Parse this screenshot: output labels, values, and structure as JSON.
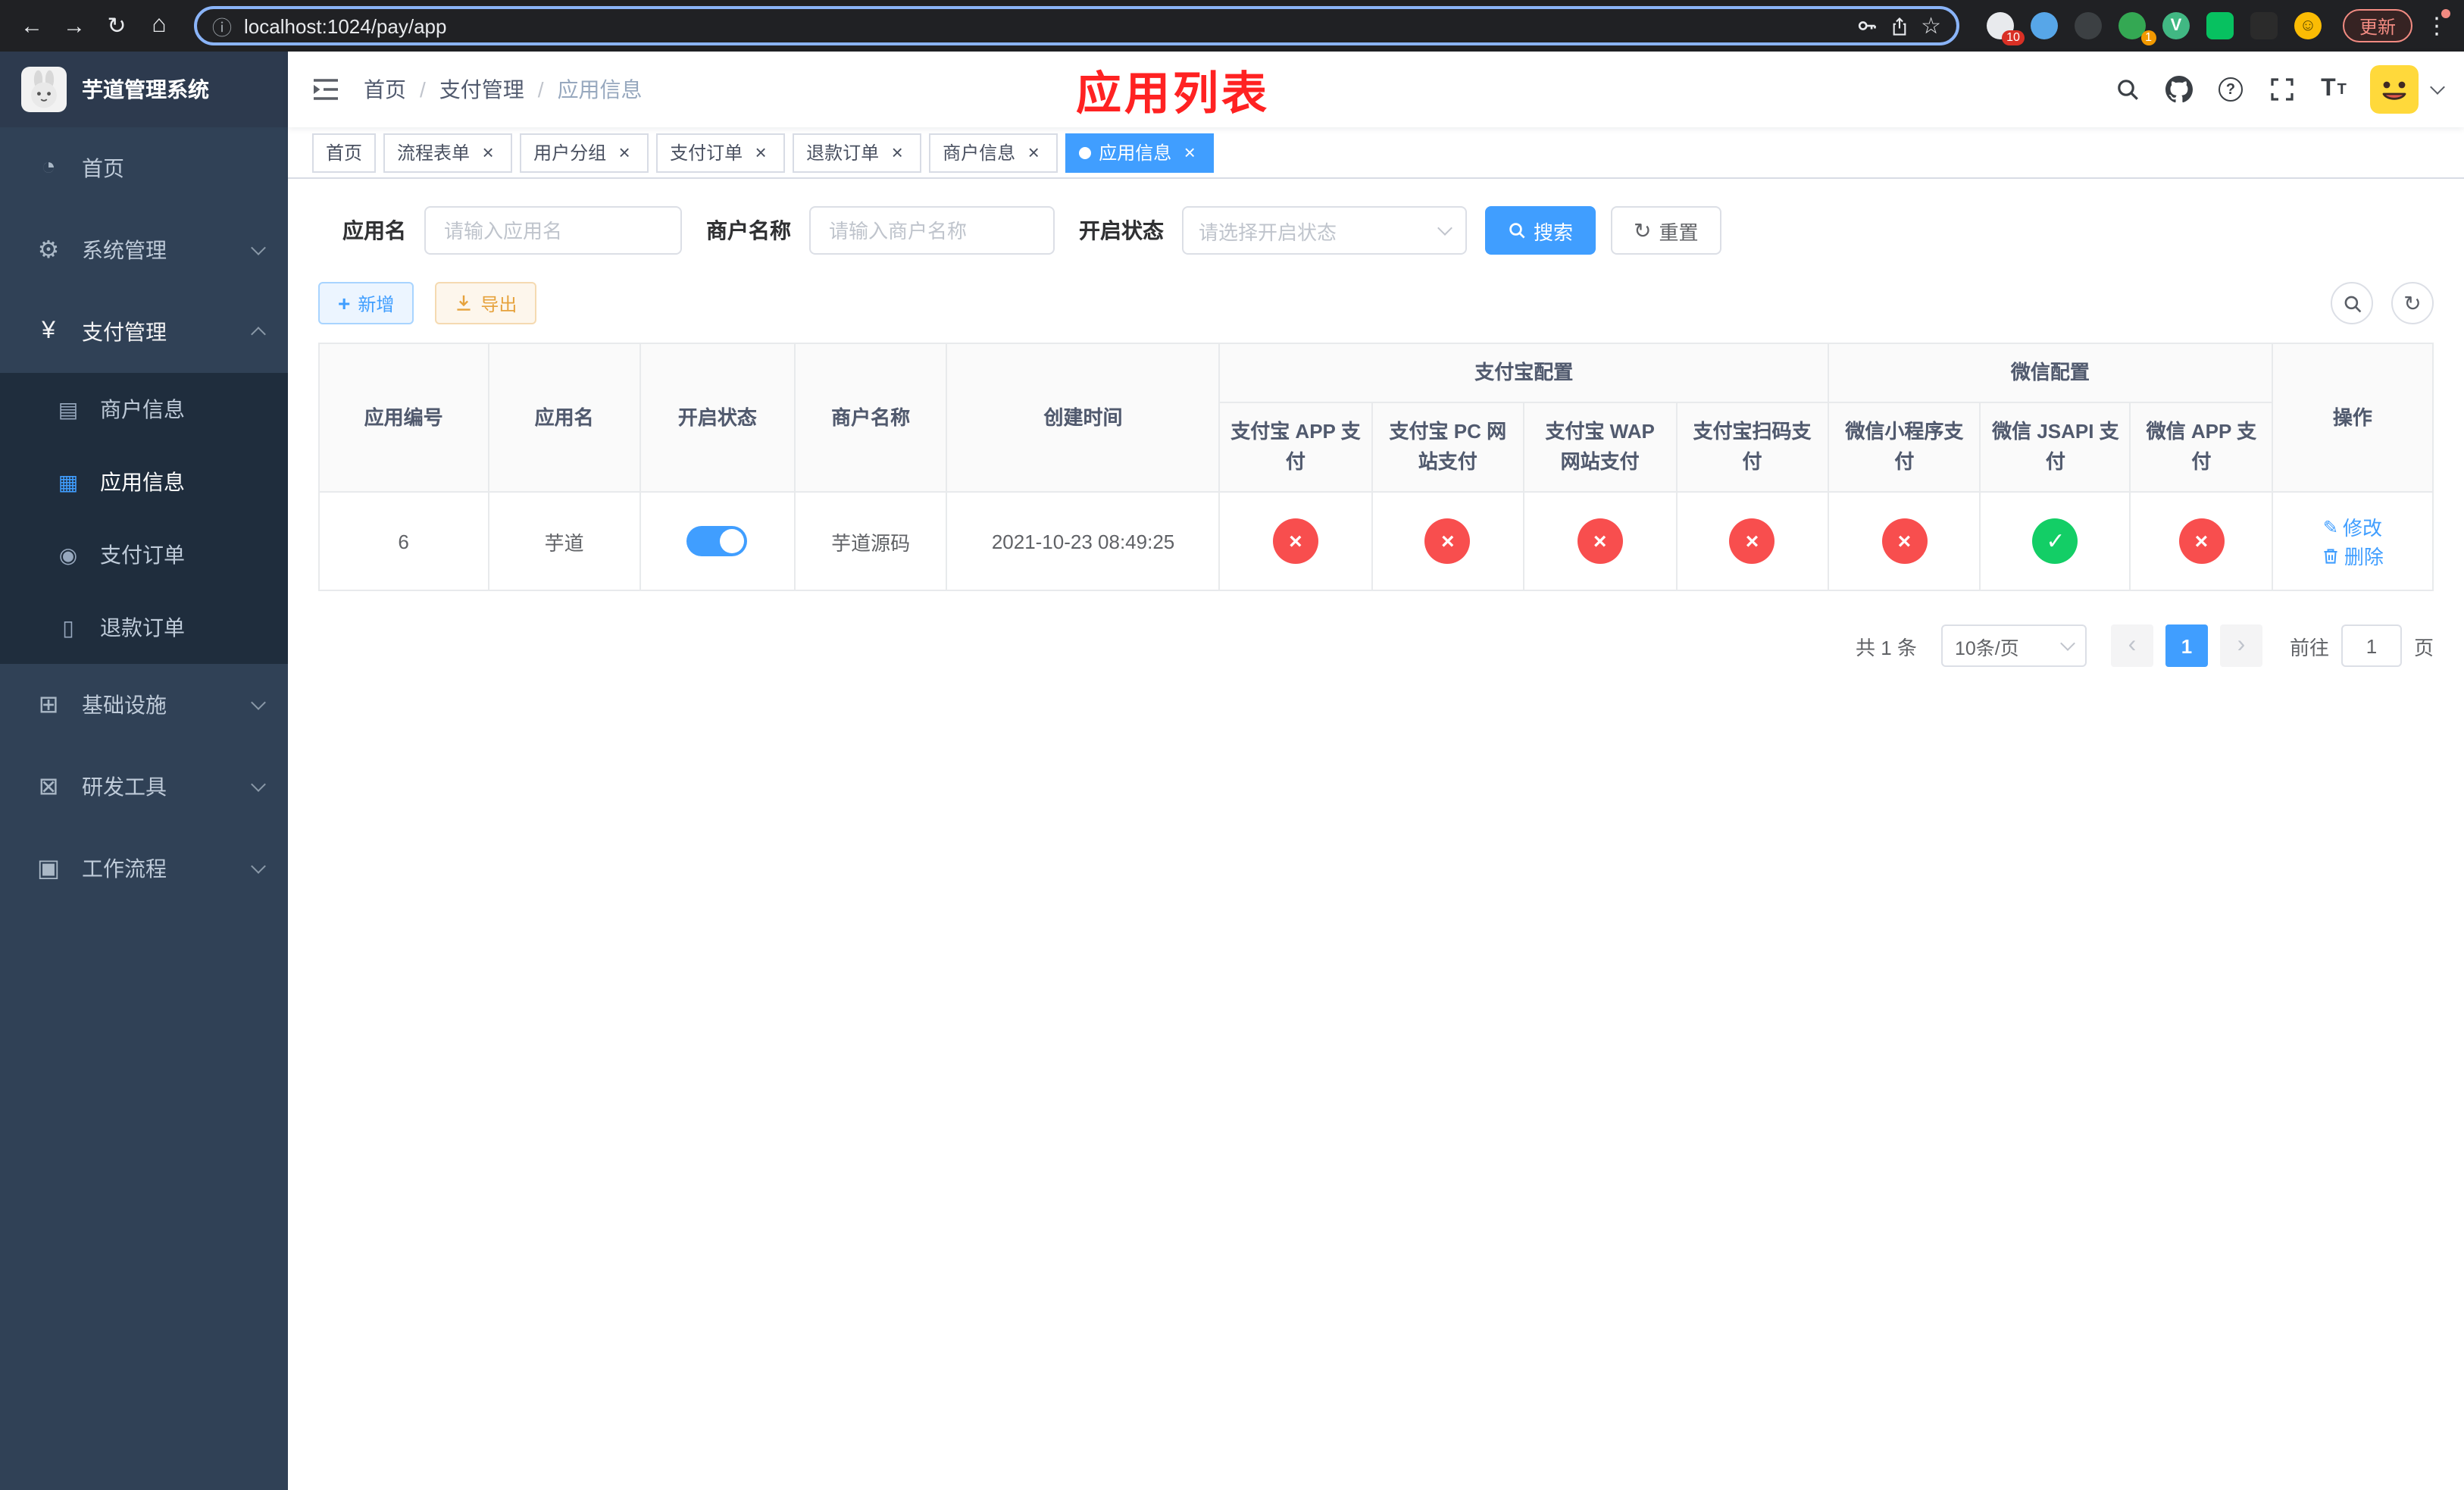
{
  "colors": {
    "primary": "#409eff",
    "success": "#13ce66",
    "danger": "#f84e4e",
    "warning": "#e6a23c",
    "annotation-red": "#ff2222",
    "sidebar-bg": "#304156",
    "sidebar-sub-bg": "#1f2d3d",
    "chrome-bg": "#202124"
  },
  "browser": {
    "url": "localhost:1024/pay/app",
    "update_label": "更新",
    "extensions": [
      {
        "color": "#e8eaed",
        "badge": "10"
      },
      {
        "color": "#57a6e8"
      },
      {
        "color": "#3c4043"
      },
      {
        "color": "#34a853",
        "badge": "1",
        "badge_color": "#f29900"
      },
      {
        "color": "#41b883",
        "label": "V"
      },
      {
        "color": "#07c160",
        "square": true
      },
      {
        "color": "#2b2b2b",
        "square": true
      },
      {
        "color": "#fbbc04",
        "label": "☺",
        "label_color": "#5f4b00"
      }
    ]
  },
  "annotation": {
    "title": "应用列表"
  },
  "sidebar": {
    "title": "芋道管理系统",
    "menu": [
      {
        "label": "首页",
        "icon": "dashboard-icon",
        "type": "item"
      },
      {
        "label": "系统管理",
        "icon": "gear-icon",
        "type": "submenu",
        "expanded": false
      },
      {
        "label": "支付管理",
        "icon": "yen-icon",
        "type": "submenu",
        "expanded": true,
        "children": [
          {
            "label": "商户信息",
            "icon": "merchant-card-icon",
            "active": false
          },
          {
            "label": "应用信息",
            "icon": "app-grid-icon",
            "active": true
          },
          {
            "label": "支付订单",
            "icon": "pay-order-icon",
            "active": false
          },
          {
            "label": "退款订单",
            "icon": "refund-order-icon",
            "active": false
          }
        ]
      },
      {
        "label": "基础设施",
        "icon": "infrastructure-icon",
        "type": "submenu",
        "expanded": false
      },
      {
        "label": "研发工具",
        "icon": "dev-tools-icon",
        "type": "submenu",
        "expanded": false
      },
      {
        "label": "工作流程",
        "icon": "workflow-icon",
        "type": "submenu",
        "expanded": false
      }
    ]
  },
  "navbar": {
    "breadcrumb": [
      "首页",
      "支付管理",
      "应用信息"
    ]
  },
  "tabs": [
    {
      "label": "首页",
      "closable": false,
      "active": false
    },
    {
      "label": "流程表单",
      "closable": true,
      "active": false
    },
    {
      "label": "用户分组",
      "closable": true,
      "active": false
    },
    {
      "label": "支付订单",
      "closable": true,
      "active": false
    },
    {
      "label": "退款订单",
      "closable": true,
      "active": false
    },
    {
      "label": "商户信息",
      "closable": true,
      "active": false
    },
    {
      "label": "应用信息",
      "closable": true,
      "active": true
    }
  ],
  "filters": {
    "app_name_label": "应用名",
    "app_name_placeholder": "请输入应用名",
    "merchant_label": "商户名称",
    "merchant_placeholder": "请输入商户名称",
    "status_label": "开启状态",
    "status_placeholder": "请选择开启状态",
    "search_label": "搜索",
    "reset_label": "重置"
  },
  "toolbar": {
    "add_label": "新增",
    "export_label": "导出"
  },
  "table": {
    "left_columns": [
      "应用编号",
      "应用名",
      "开启状态",
      "商户名称",
      "创建时间"
    ],
    "groups": [
      {
        "label": "支付宝配置",
        "children": [
          "支付宝 APP 支付",
          "支付宝 PC 网站支付",
          "支付宝 WAP 网站支付",
          "支付宝扫码支付"
        ]
      },
      {
        "label": "微信配置",
        "children": [
          "微信小程序支付",
          "微信 JSAPI 支付",
          "微信 APP 支付"
        ]
      }
    ],
    "right_columns": [
      "操作"
    ],
    "rows": [
      {
        "app_id": "6",
        "app_name": "芋道",
        "enabled": true,
        "merchant_name": "芋道源码",
        "create_time": "2021-10-23 08:49:25",
        "statuses": [
          false,
          false,
          false,
          false,
          false,
          true,
          false
        ],
        "edit_label": "修改",
        "delete_label": "删除"
      }
    ]
  },
  "pagination": {
    "total": "共 1 条",
    "page_size": "10条/页",
    "current": "1",
    "goto_label": "前往",
    "goto_value": "1",
    "unit": "页"
  }
}
